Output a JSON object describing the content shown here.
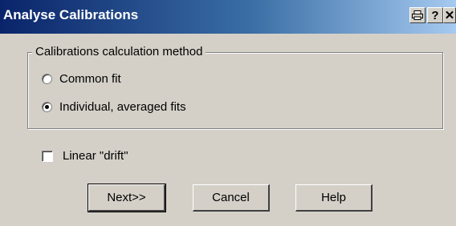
{
  "window": {
    "title": "Analyse Calibrations",
    "print_glyph": "🖶",
    "help_glyph": "?",
    "close_glyph": "✕"
  },
  "group": {
    "legend": "Calibrations calculation method",
    "options": [
      {
        "label": "Common fit",
        "selected": false
      },
      {
        "label": "Individual, averaged fits",
        "selected": true
      }
    ]
  },
  "drift": {
    "label": "Linear \"drift\"",
    "checked": false
  },
  "buttons": {
    "next": "Next>>",
    "cancel": "Cancel",
    "help": "Help"
  }
}
